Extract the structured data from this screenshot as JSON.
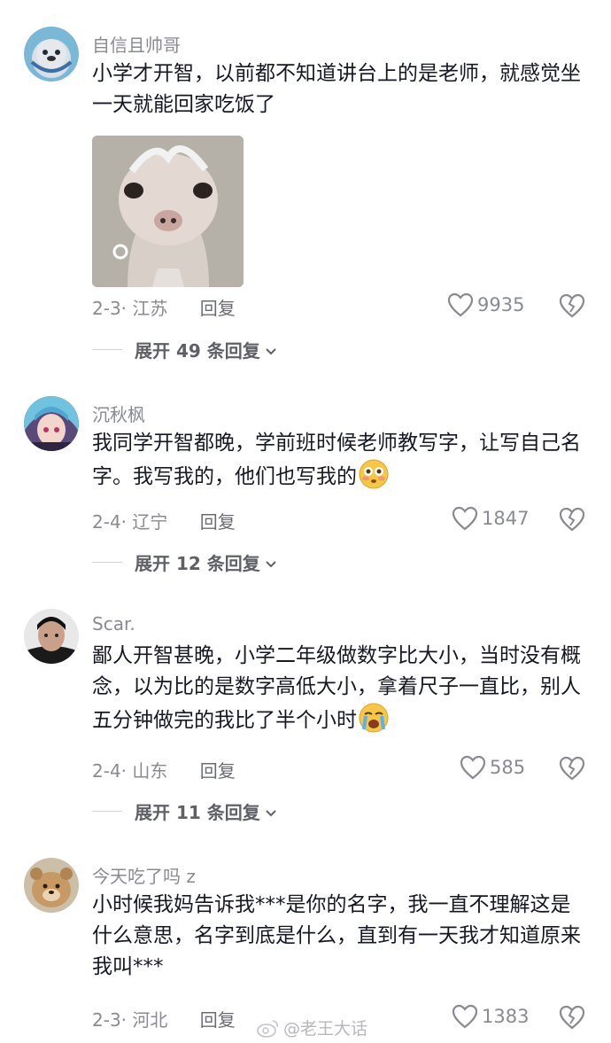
{
  "comments": [
    {
      "username": "自信且帅哥",
      "text": "小学才开智，以前都不知道讲台上的是老师，就感觉坐一天就能回家吃饭了",
      "meta": "2-3· 江苏",
      "reply_label": "回复",
      "likes": "9935",
      "expand_label": "展开 49 条回复",
      "has_image": true
    },
    {
      "username": "沉秋枫",
      "text": "我同学开智都晚，学前班时候老师教写字，让写自己名字。我写我的，他们也写我的",
      "emoji": "flushed-face",
      "meta": "2-4· 辽宁",
      "reply_label": "回复",
      "likes": "1847",
      "expand_label": "展开 12 条回复"
    },
    {
      "username": "Scar.",
      "text": "鄙人开智甚晚，小学二年级做数字比大小，当时没有概念，以为比的是数字高低大小，拿着尺子一直比，别人五分钟做完的我比了半个小时",
      "emoji": "crying-face",
      "meta": "2-4· 山东",
      "reply_label": "回复",
      "likes": "585",
      "expand_label": "展开 11 条回复"
    },
    {
      "username": "今天吃了吗 z",
      "text": "小时候我妈告诉我***是你的名字，我一直不理解这是什么意思，名字到底是什么，直到有一天我才知道原来我叫***",
      "meta": "2-3· 河北",
      "reply_label": "回复",
      "likes": "1383"
    }
  ],
  "watermark": "@老王大话",
  "colors": {
    "text": "#161823",
    "secondary": "#8a8b91",
    "background": "#ffffff"
  }
}
